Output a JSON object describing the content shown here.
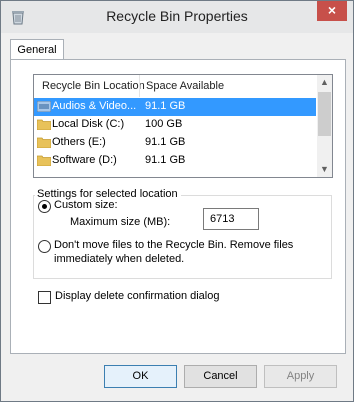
{
  "window": {
    "title": "Recycle Bin Properties",
    "close_glyph": "×"
  },
  "tabs": [
    {
      "label": "General"
    }
  ],
  "list": {
    "columns": {
      "location": "Recycle Bin Location",
      "space": "Space Available"
    },
    "rows": [
      {
        "name": "Audios & Video...",
        "space": "91.1 GB",
        "selected": true
      },
      {
        "name": "Local Disk (C:)",
        "space": "100 GB",
        "selected": false
      },
      {
        "name": "Others (E:)",
        "space": "91.1 GB",
        "selected": false
      },
      {
        "name": "Software (D:)",
        "space": "91.1 GB",
        "selected": false
      }
    ]
  },
  "settings": {
    "group_label": "Settings for selected location",
    "custom_size_label": "Custom size:",
    "max_size_label": "Maximum size (MB):",
    "max_size_value": "6713",
    "dont_move_label_1": "Don't move files to the Recycle Bin. Remove files",
    "dont_move_label_2": "immediately when deleted.",
    "custom_selected": true
  },
  "confirm_dialog_label": "Display delete confirmation dialog",
  "buttons": {
    "ok": "OK",
    "cancel": "Cancel",
    "apply": "Apply"
  },
  "colors": {
    "selection": "#3399ff",
    "close": "#c7504a",
    "folder": "#e8c25a"
  }
}
